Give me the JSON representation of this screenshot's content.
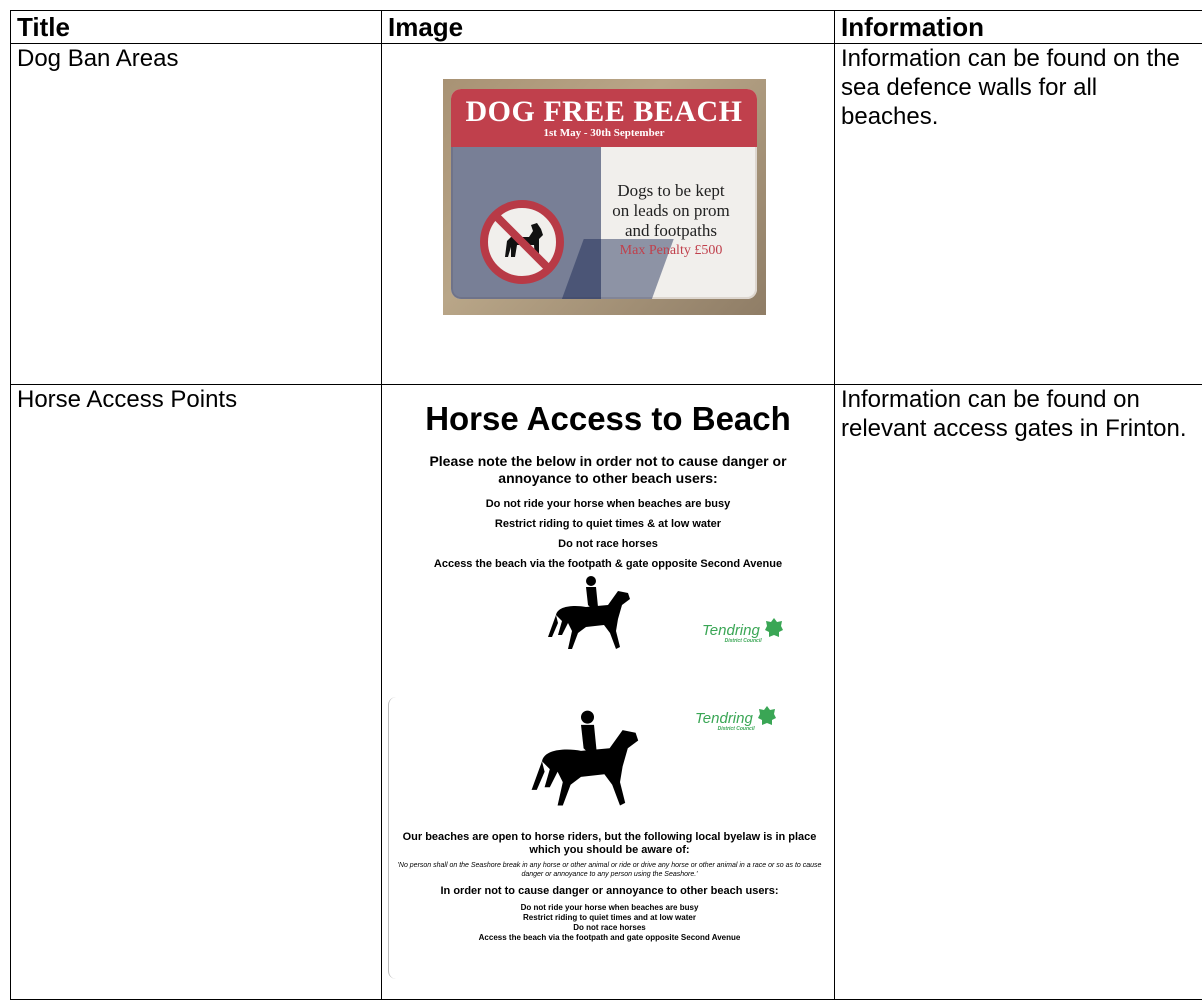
{
  "table": {
    "headers": {
      "title": "Title",
      "image": "Image",
      "information": "Information"
    },
    "rows": [
      {
        "title": "Dog Ban Areas",
        "information": "Information can be found on the sea defence walls for all beaches.",
        "sign": {
          "heading": "DOG FREE BEACH",
          "dates": "1st May - 30th September",
          "line1": "Dogs to be kept",
          "line2": "on leads on prom",
          "line3": "and footpaths",
          "penalty": "Max Penalty £500",
          "icon": "no-dogs-icon"
        }
      },
      {
        "title": "Horse Access Points",
        "information": "Information can be found on relevant access gates in Frinton.",
        "poster1": {
          "title": "Horse Access to Beach",
          "note": "Please note the below in order not to cause danger or annoyance to other beach users:",
          "lines": [
            "Do not ride your horse when beaches are busy",
            "Restrict riding to quiet times & at low water",
            "Do not race horses",
            "Access the beach via the footpath & gate opposite Second Avenue"
          ],
          "logo_name": "Tendring",
          "logo_sub": "District Council"
        },
        "poster2": {
          "logo_name": "Tendring",
          "logo_sub": "District Council",
          "heading": "Our beaches are open to horse riders, but the following local byelaw is in place which you should be aware of:",
          "quote": "'No person shall on the Seashore break in any horse or other animal or ride or drive any horse or other animal in a race or so as to cause danger or annoyance to any person using the Seashore.'",
          "subheading": "In order not to cause danger or annoyance to other beach users:",
          "lines": [
            "Do not ride your horse when beaches are busy",
            "Restrict riding to quiet times and at low water",
            "Do not race horses",
            "Access the beach via the footpath and gate opposite Second Avenue"
          ]
        }
      }
    ]
  },
  "colors": {
    "sign_red": "#c0404c",
    "logo_green": "#3aa655"
  }
}
